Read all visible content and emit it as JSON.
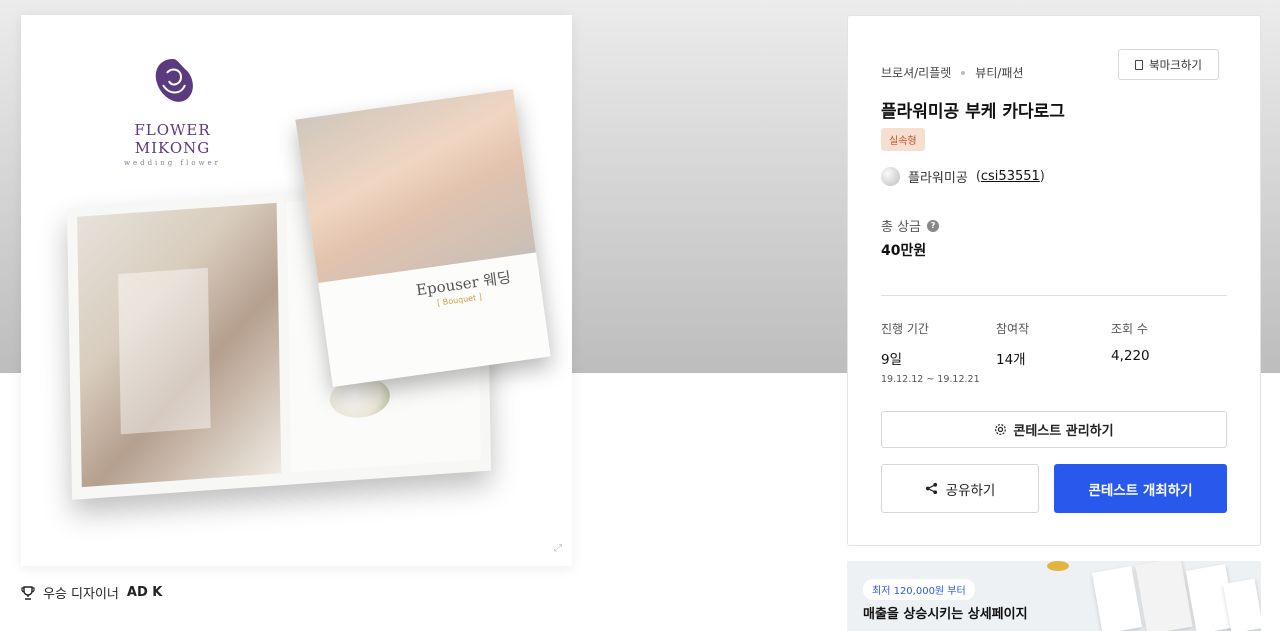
{
  "artwork": {
    "brand": "FLOWER MIKONG",
    "brand_sub": "wedding flower",
    "booklet_title": "Epouser 웨딩",
    "booklet_sub": "[ Bouquet ]"
  },
  "award": {
    "label": "우승 디자이너",
    "designer": "AD K"
  },
  "panel": {
    "breadcrumb": [
      "브로셔/리플렛",
      "뷰티/패션"
    ],
    "bookmark_label": "북마크하기",
    "title": "플라워미공 부케 카다로그",
    "badge": "실속형",
    "host_name": "플라워미공",
    "host_id": "csi53551",
    "prize_label": "총 상금",
    "prize_value": "40만원",
    "stats": {
      "period_label": "진행 기간",
      "period_value": "9일",
      "period_range": "19.12.12 ~ 19.12.21",
      "entries_label": "참여작",
      "entries_value": "14개",
      "views_label": "조회 수",
      "views_value": "4,220"
    },
    "manage_label": "콘테스트 관리하기",
    "share_label": "공유하기",
    "host_button_label": "콘테스트 개최하기"
  },
  "ad": {
    "pill": "최저 120,000원 부터",
    "text": "매출을 상승시키는 상세페이지"
  },
  "colors": {
    "primary": "#2958ec",
    "badge_bg": "#f6dfd0",
    "badge_text": "#c0532a",
    "brand_purple": "#5b3a7e"
  }
}
